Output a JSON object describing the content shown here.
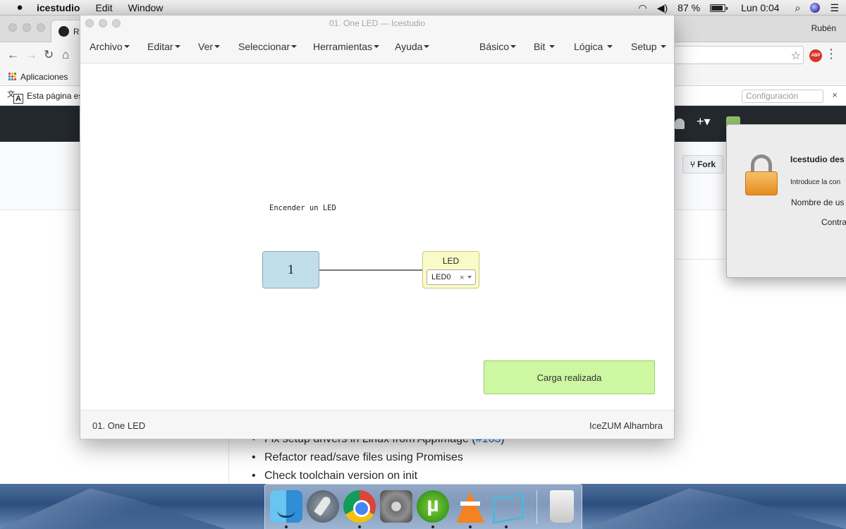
{
  "menubar": {
    "apple": "",
    "app_name": "icestudio",
    "items": [
      "Edit",
      "Window"
    ],
    "battery": "87 %",
    "clock": "Lun 0:04"
  },
  "chrome": {
    "tab_title": "Re",
    "user": "Rubén",
    "bookmarks_apps": "Aplicaciones",
    "translate_text": "Esta página es",
    "translate_config": "Configuración",
    "close_glyph": "×",
    "star_glyph": "☆",
    "abp": "ABP",
    "plus": "+▾",
    "fork": "Fork",
    "changelog": {
      "item1_prefix": "Fix setup drivers in Linux from AppImage (",
      "item1_link": "#163",
      "item1_suffix": ")",
      "item2": "Refactor read/save files using Promises",
      "item3": "Check toolchain version on init"
    }
  },
  "auth_dialog": {
    "title": "Icestudio des",
    "description": "Introduce la con",
    "username_label": "Nombre de us",
    "password_label": "Contra"
  },
  "icestudio": {
    "window_title": "01. One LED — Icestudio",
    "menus_left": [
      "Archivo",
      "Editar",
      "Ver",
      "Seleccionar",
      "Herramientas",
      "Ayuda"
    ],
    "menus_right": [
      "Básico",
      "Bit",
      "Lógica",
      "Setup"
    ],
    "comment": "Encender un LED",
    "constant_value": "1",
    "led_block": {
      "name": "LED",
      "selected_pin": "LED0",
      "clear_glyph": "×"
    },
    "toast": "Carga realizada",
    "status_left": "01. One LED",
    "status_right": "IceZUM Alhambra"
  },
  "dock": {
    "apps": [
      "finder-icon",
      "launchpad-icon",
      "chrome-icon",
      "system-preferences-icon",
      "utorrent-icon",
      "vlc-icon",
      "icestudio-icon",
      "trash-icon"
    ]
  }
}
